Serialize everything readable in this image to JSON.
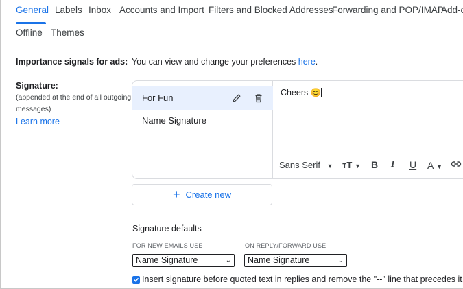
{
  "tabs": [
    "General",
    "Labels",
    "Inbox",
    "Accounts and Import",
    "Filters and Blocked Addresses",
    "Forwarding and POP/IMAP",
    "Add-o",
    "Offline",
    "Themes"
  ],
  "importance": {
    "label": "Importance signals for ads:",
    "text": "You can view and change your preferences ",
    "link": "here",
    "period": "."
  },
  "signature": {
    "label": "Signature:",
    "subtext_line1": "(appended at the end of all outgoing",
    "subtext_line2": "messages)",
    "learn_more": "Learn more",
    "items": [
      "For Fun",
      "Name Signature"
    ],
    "editor_text": "Cheers 😊",
    "toolbar": {
      "font": "Sans Serif",
      "bold": "B",
      "italic": "I",
      "underline": "U",
      "text_color": "A"
    },
    "create_new": "Create new"
  },
  "defaults": {
    "title": "Signature defaults",
    "new_emails_label": "FOR NEW EMAILS USE",
    "new_emails_value": "Name Signature",
    "reply_label": "ON REPLY/FORWARD USE",
    "reply_value": "Name Signature",
    "insert_text": "Insert signature before quoted text in replies and remove the \"--\" line that precedes it."
  },
  "colors": {
    "accent": "#1a73e8",
    "selected_bg": "#e8f0fe"
  }
}
